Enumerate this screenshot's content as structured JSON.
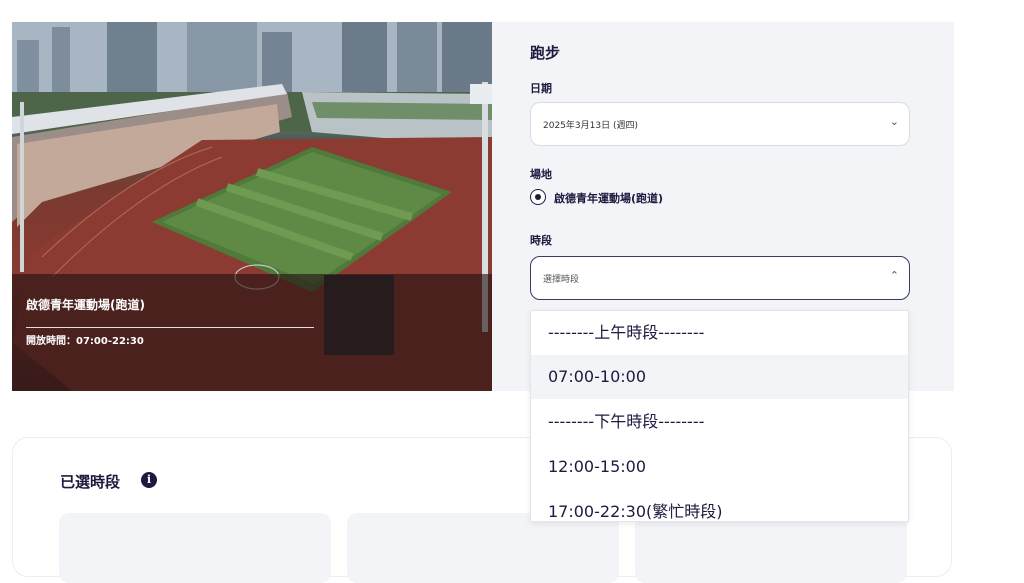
{
  "venue": {
    "name": "啟德青年運動場(跑道)",
    "hours": "開放時間：07:00-22:30"
  },
  "booking": {
    "activity": "跑步",
    "date_label": "日期",
    "date_value": "2025年3月13日 (週四)",
    "venue_label": "場地",
    "venue_option": "啟德青年運動場(跑道)",
    "timeslot_label": "時段",
    "timeslot_placeholder": "選擇時段",
    "icons": {
      "date_chevron": "chevron-down-icon",
      "timeslot_chevron": "chevron-up-icon"
    }
  },
  "dropdown": {
    "options": [
      {
        "label": "--------上午時段--------",
        "type": "header"
      },
      {
        "label": "07:00-10:00",
        "type": "slot",
        "state": "hover"
      },
      {
        "label": "--------下午時段--------",
        "type": "header"
      },
      {
        "label": "12:00-15:00",
        "type": "slot"
      },
      {
        "label": "17:00-22:30(繁忙時段)",
        "type": "slot"
      }
    ]
  },
  "selected": {
    "title": "已選時段",
    "info_icon": "info-icon",
    "info_glyph": "i"
  },
  "colors": {
    "primary": "#1c1a3f",
    "panel_bg": "#f2f4f8",
    "track_red": "#8a3b30",
    "field_green": "#4f7a3a"
  }
}
